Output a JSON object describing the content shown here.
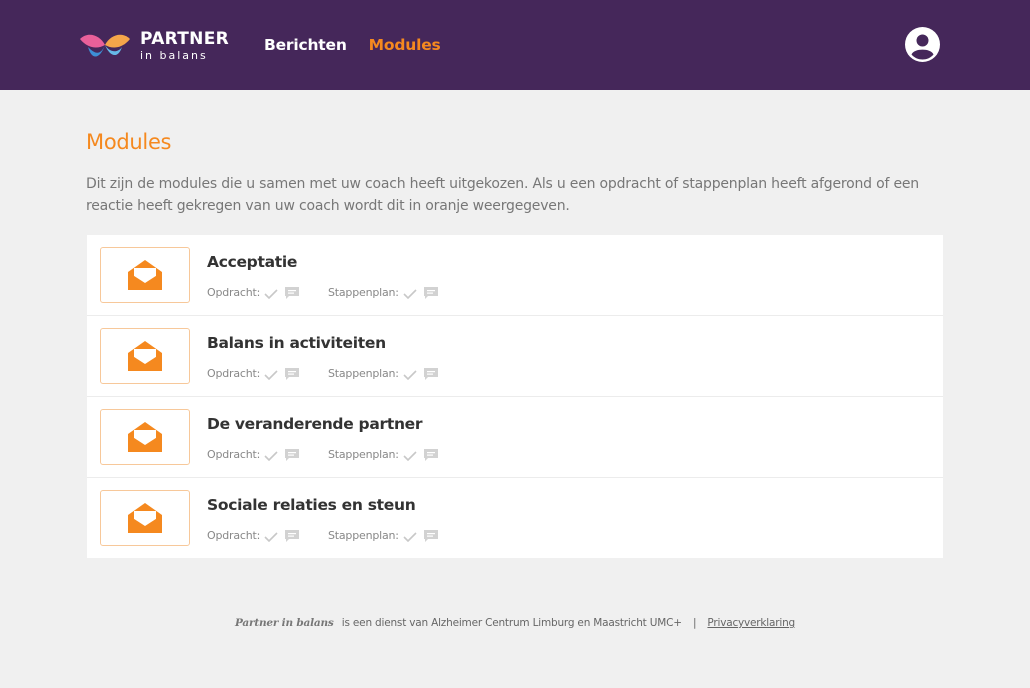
{
  "header": {
    "brand_title": "PARTNER",
    "brand_subtitle": "in balans",
    "nav": [
      {
        "label": "Berichten",
        "active": false
      },
      {
        "label": "Modules",
        "active": true
      }
    ],
    "colors": {
      "bar": "#45275a",
      "accent": "#f5891f"
    },
    "avatar_icon": "user-circle-icon"
  },
  "main": {
    "title": "Modules",
    "intro": "Dit zijn de modules die u samen met uw coach heeft uitgekozen. Als u een opdracht of stappenplan heeft afgerond of een reactie heeft gekregen van uw coach wordt dit in oranje weergegeven.",
    "status_labels": {
      "assignment": "Opdracht:",
      "plan": "Stappenplan:"
    },
    "modules": [
      {
        "name": "Acceptatie",
        "icon": "envelope-open-icon"
      },
      {
        "name": "Balans in activiteiten",
        "icon": "envelope-open-icon"
      },
      {
        "name": "De veranderende partner",
        "icon": "envelope-open-icon"
      },
      {
        "name": "Sociale relaties en steun",
        "icon": "envelope-open-icon"
      }
    ]
  },
  "footer": {
    "brand": "Partner in balans",
    "text": "is een dienst van Alzheimer Centrum Limburg en Maastricht UMC+",
    "separator": "|",
    "privacy_link": "Privacyverklaring"
  }
}
